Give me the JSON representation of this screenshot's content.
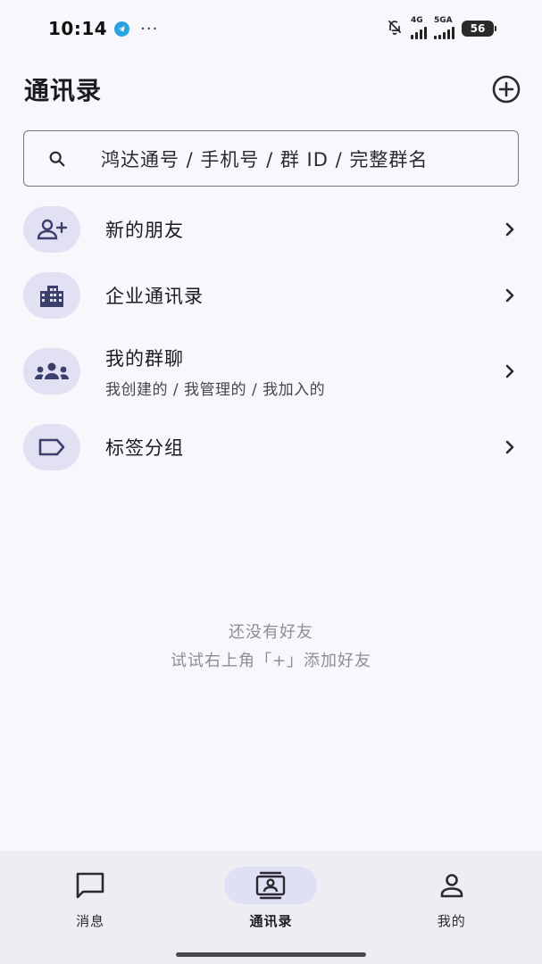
{
  "status_bar": {
    "time": "10:14",
    "more": "···",
    "signal_1_label": "4G",
    "signal_2_label": "5GA",
    "battery": "56"
  },
  "header": {
    "title": "通讯录",
    "add_icon": "add-circle-icon"
  },
  "search": {
    "placeholder": "鸿达通号 / 手机号 / 群 ID / 完整群名",
    "icon": "search-icon"
  },
  "list": {
    "items": [
      {
        "label": "新的朋友",
        "icon": "person-add-icon"
      },
      {
        "label": "企业通讯录",
        "icon": "building-icon"
      },
      {
        "label": "我的群聊",
        "sub": "我创建的 / 我管理的 / 我加入的",
        "icon": "group-icon"
      },
      {
        "label": "标签分组",
        "icon": "label-tag-icon"
      }
    ]
  },
  "empty_state": {
    "title": "还没有好友",
    "hint": "试试右上角「+」添加好友"
  },
  "bottom_nav": {
    "items": [
      {
        "label": "消息",
        "icon": "chat-bubble-icon"
      },
      {
        "label": "通讯录",
        "icon": "contacts-icon"
      },
      {
        "label": "我的",
        "icon": "person-icon"
      }
    ],
    "active": "通讯录"
  },
  "colors": {
    "background": "#f8f7fc",
    "icon_circle": "#e2e1f4",
    "icon_fg": "#3b3f6b",
    "nav_background": "#eeedf4",
    "nav_active_pill": "#dfdff6",
    "muted_text": "#8e8d95"
  }
}
